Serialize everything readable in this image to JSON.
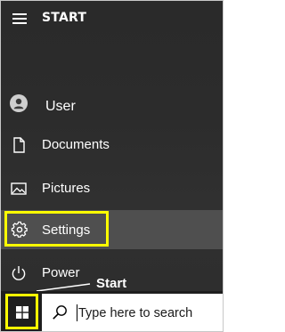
{
  "start_menu": {
    "title": "START",
    "items": [
      {
        "label": "User",
        "icon": "user-icon"
      },
      {
        "label": "Documents",
        "icon": "document-icon"
      },
      {
        "label": "Pictures",
        "icon": "pictures-icon"
      },
      {
        "label": "Settings",
        "icon": "gear-icon"
      },
      {
        "label": "Power",
        "icon": "power-icon"
      }
    ]
  },
  "annotation": {
    "start_label": "Start",
    "highlight_color": "#ffff00"
  },
  "taskbar": {
    "start_icon": "windows-logo-icon",
    "search_placeholder": "Type here to search",
    "search_icon": "search-icon"
  },
  "colors": {
    "panel_bg": "#2b2b2b",
    "selected_bg": "#4f4f4f",
    "taskbar_bg": "#1e1e1e",
    "highlight": "#ffff00"
  }
}
